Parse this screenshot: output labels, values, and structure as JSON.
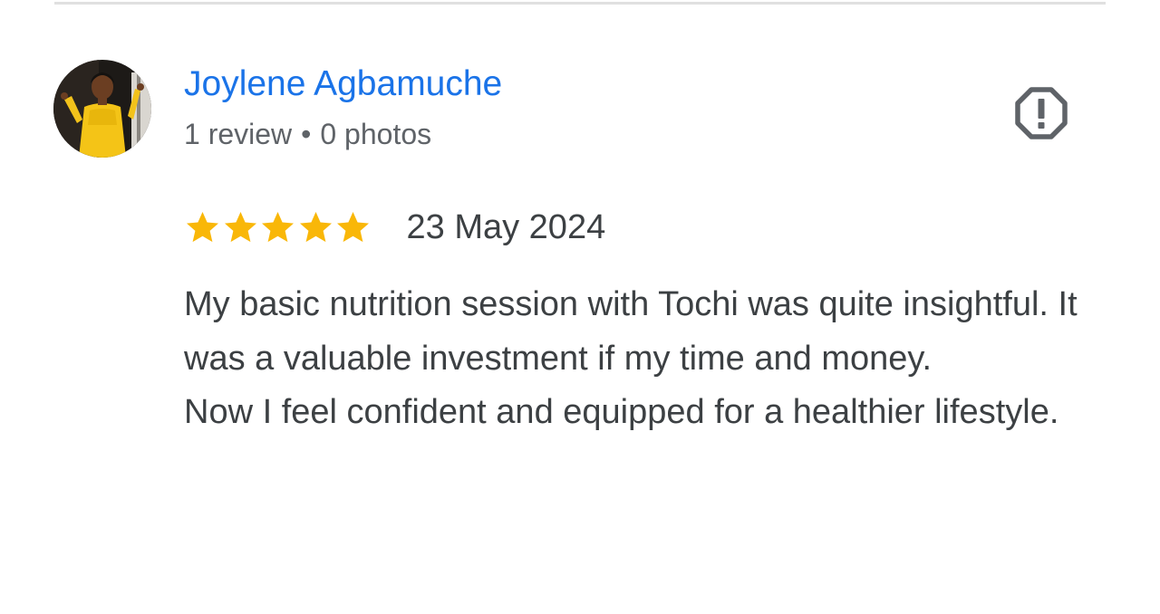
{
  "review": {
    "reviewer": {
      "name": "Joylene Agbamuche",
      "review_count": "1 review",
      "separator": "•",
      "photo_count": "0 photos",
      "avatar_icon": "user-avatar-photo"
    },
    "report_icon": "report-flag-icon",
    "rating": {
      "stars": 5,
      "max": 5,
      "star_color": "#f9b708"
    },
    "date": "23 May 2024",
    "text": {
      "paragraph_1": "My basic nutrition session with Tochi was quite insightful. It was a valuable investment if my time and money.",
      "paragraph_2": "Now I feel confident and equipped for a healthier lifestyle."
    }
  },
  "colors": {
    "name_link": "#1a73e8",
    "meta_text": "#5f6368",
    "body_text": "#3c4043",
    "divider": "#e0e0e0",
    "icon": "#5f6368"
  }
}
